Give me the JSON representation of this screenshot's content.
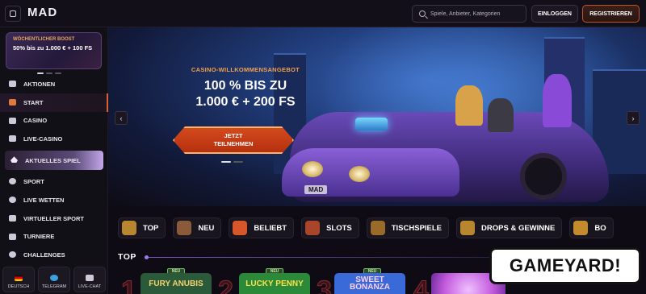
{
  "header": {
    "logo": "MAD",
    "search_placeholder": "Spiele, Anbieter, Kategorien",
    "login_label": "EINLOGGEN",
    "register_label": "REGISTRIEREN"
  },
  "sidebar": {
    "promo": {
      "tag": "WÖCHENTLICHER BOOST",
      "text": "50% bis zu 1.000 € + 100 FS"
    },
    "items": [
      {
        "label": "AKTIONEN",
        "icon": "gift-icon"
      },
      {
        "label": "START",
        "icon": "home-icon"
      },
      {
        "label": "CASINO",
        "icon": "casino-icon"
      },
      {
        "label": "LIVE-CASINO",
        "icon": "live-casino-icon"
      },
      {
        "label": "AKTUELLES SPIEL",
        "icon": "flame-icon"
      },
      {
        "label": "SPORT",
        "icon": "soccer-ball-icon"
      },
      {
        "label": "LIVE WETTEN",
        "icon": "live-icon"
      },
      {
        "label": "VIRTUELLER SPORT",
        "icon": "gamepad-icon"
      },
      {
        "label": "TURNIERE",
        "icon": "trophy-icon"
      },
      {
        "label": "CHALLENGES",
        "icon": "target-icon"
      }
    ],
    "bottom": [
      {
        "label": "DEUTSCH",
        "icon": "german-flag-icon"
      },
      {
        "label": "TELEGRAM",
        "icon": "telegram-icon"
      },
      {
        "label": "LIVE-CHAT",
        "icon": "chat-icon"
      }
    ]
  },
  "hero": {
    "tag": "CASINO-WILLKOMMENSANGEBOT",
    "headline_line1": "100 % BIS ZU",
    "headline_line2": "1.000 € + 200 FS",
    "cta_line1": "JETZT",
    "cta_line2": "TEILNEHMEN",
    "plate": "MAD",
    "prev_arrow": "‹",
    "next_arrow": "›"
  },
  "categories": [
    {
      "label": "TOP",
      "color": "#b8862e"
    },
    {
      "label": "NEU",
      "color": "#8a5a3a"
    },
    {
      "label": "BELIEBT",
      "color": "#d8562a"
    },
    {
      "label": "SLOTS",
      "color": "#a8452a"
    },
    {
      "label": "TISCHSPIELE",
      "color": "#9a6a2a"
    },
    {
      "label": "DROPS & GEWINNE",
      "color": "#b8862e"
    },
    {
      "label": "BO",
      "color": "#c48a2e"
    }
  ],
  "top_section": {
    "title": "TOP",
    "badge": "NEU",
    "games": [
      {
        "title": "FURY ANUBIS",
        "bg": "#2b5a3a",
        "fg": "#f4d46a"
      },
      {
        "title": "LUCKY PENNY",
        "bg": "#2a8a3a",
        "fg": "#ffe04a"
      },
      {
        "title": "SWEET BONANZA",
        "bg": "#3a6ad8",
        "fg": "#ffd0f0"
      },
      {
        "title": "",
        "bg": "#c25adc",
        "fg": "#ffffff"
      }
    ],
    "numbers": [
      "1",
      "2",
      "3",
      "4"
    ]
  },
  "watermark": "GAMEYARD!"
}
